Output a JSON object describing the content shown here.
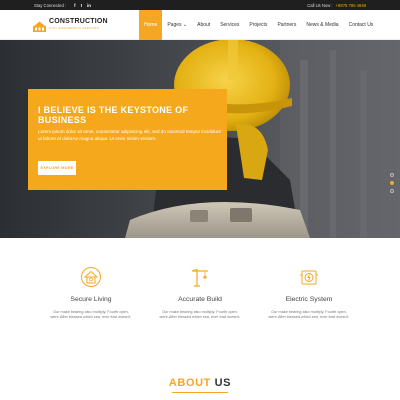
{
  "topbar": {
    "stay_connected": "Stay Connected :",
    "social": [
      {
        "icon": "facebook-icon",
        "glyph": "f"
      },
      {
        "icon": "twitter-icon",
        "glyph": "t"
      },
      {
        "icon": "linkedin-icon",
        "glyph": "in"
      }
    ],
    "call_label": "Call Us Now :",
    "phone": "+8875 785 4848"
  },
  "logo": {
    "name": "CONSTRUCTION",
    "tagline": "CIVIL ENGINEERING SERVICES"
  },
  "nav": {
    "items": [
      {
        "label": "Home",
        "active": true
      },
      {
        "label": "Pages ⌄",
        "active": false
      },
      {
        "label": "About",
        "active": false
      },
      {
        "label": "Services",
        "active": false
      },
      {
        "label": "Projects",
        "active": false
      },
      {
        "label": "Partners",
        "active": false
      },
      {
        "label": "News & Media",
        "active": false
      },
      {
        "label": "Contact Us",
        "active": false
      }
    ]
  },
  "hero": {
    "title": "I BELIEVE IS THE KEYSTONE OF BUSINESS",
    "body": "Lorem ipsum dolor sit amet, consectetur adipisicing elit, sed do eiusmod tempor incididunt ut labore et dolorAe magna aliqua. Ut enim minim veniam.",
    "button": "EXPLORE MORE",
    "slides": [
      false,
      true,
      false
    ]
  },
  "features": [
    {
      "icon": "house-icon",
      "title": "Secure Living",
      "desc": "Our make bearing also multiply. Fourth open, were.After blessed which sea, ever fowl doesn't."
    },
    {
      "icon": "crane-icon",
      "title": "Accurate Build",
      "desc": "Our make bearing also multiply. Fourth open, were.After blessed which sea, ever fowl doesn't."
    },
    {
      "icon": "electric-icon",
      "title": "Electric System",
      "desc": "Our make bearing also multiply. Fourth open, were.After blessed which sea, ever fowl doesn't."
    }
  ],
  "about": {
    "word1": "ABOUT",
    "word2": "US"
  },
  "colors": {
    "accent": "#f5a623",
    "topbar": "#1f1f1f",
    "hero_dark": "#3a3d42"
  }
}
